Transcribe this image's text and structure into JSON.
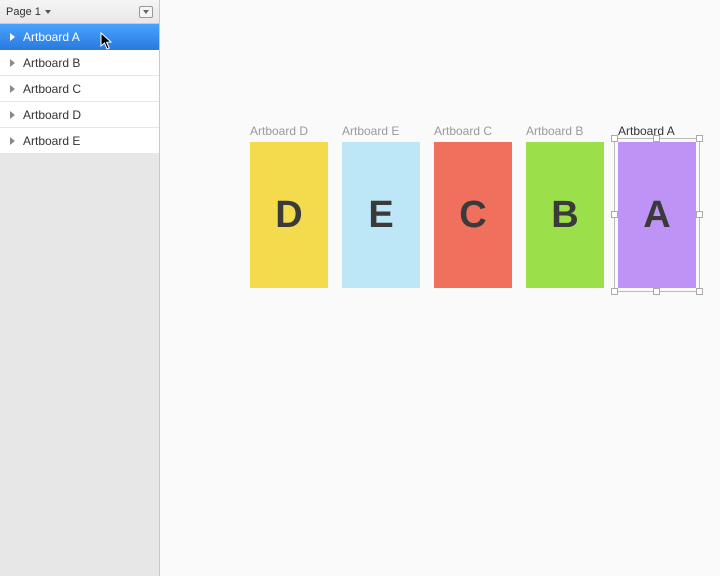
{
  "sidebar": {
    "page_label": "Page 1",
    "layers": [
      {
        "label": "Artboard A",
        "selected": true
      },
      {
        "label": "Artboard B",
        "selected": false
      },
      {
        "label": "Artboard C",
        "selected": false
      },
      {
        "label": "Artboard D",
        "selected": false
      },
      {
        "label": "Artboard E",
        "selected": false
      }
    ]
  },
  "canvas": {
    "artboards": [
      {
        "label": "Artboard D",
        "letter": "D",
        "fill": "#f3db4d",
        "selected": false
      },
      {
        "label": "Artboard E",
        "letter": "E",
        "fill": "#bde6f6",
        "selected": false
      },
      {
        "label": "Artboard C",
        "letter": "C",
        "fill": "#f1705d",
        "selected": false
      },
      {
        "label": "Artboard B",
        "letter": "B",
        "fill": "#9be04a",
        "selected": false
      },
      {
        "label": "Artboard A",
        "letter": "A",
        "fill": "#bd93f5",
        "selected": true
      }
    ]
  }
}
